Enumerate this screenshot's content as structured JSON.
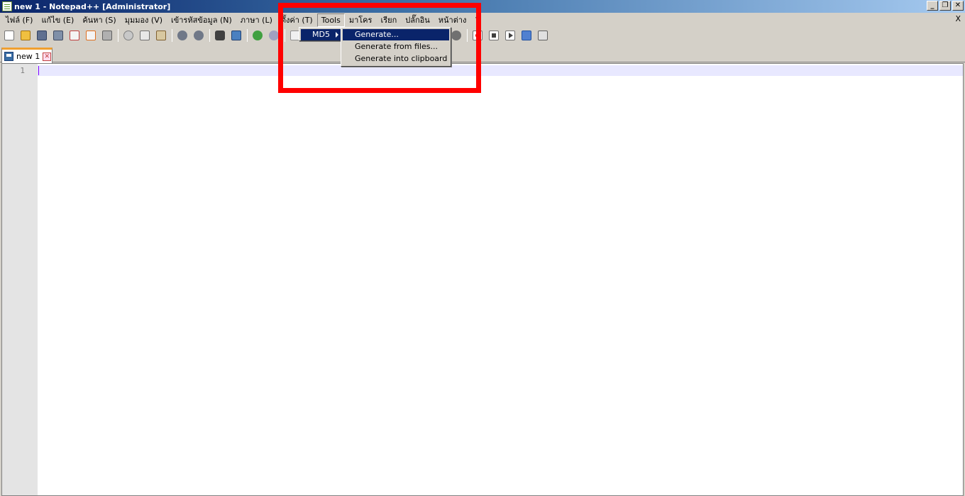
{
  "window": {
    "title": "new 1 - Notepad++ [Administrator]",
    "minimize": "_",
    "restore": "❐",
    "close": "✕"
  },
  "menubar": {
    "items": [
      "ไฟล์ (F)",
      "แก้ไข (E)",
      "ค้นหา (S)",
      "มุมมอง (V)",
      "เข้ารหัสข้อมูล (N)",
      "ภาษา (L)",
      "ตั้งค่า (T)",
      "Tools",
      "มาโคร",
      "เรียก",
      "ปลั๊กอิน",
      "หน้าต่าง",
      "?"
    ],
    "close_doc": "X"
  },
  "tabs": [
    {
      "label": "new 1",
      "close": "✕"
    }
  ],
  "editor": {
    "line_numbers": [
      "1"
    ]
  },
  "tools_menu": {
    "items": [
      {
        "label": "MD5"
      }
    ]
  },
  "md5_submenu": {
    "items": [
      {
        "label": "Generate..."
      },
      {
        "label": "Generate from files..."
      },
      {
        "label": "Generate into clipboard"
      }
    ]
  },
  "colors": {
    "menu_highlight": "#0a246a",
    "annotation_box": "#ff0000",
    "current_line": "#e8e8ff"
  }
}
